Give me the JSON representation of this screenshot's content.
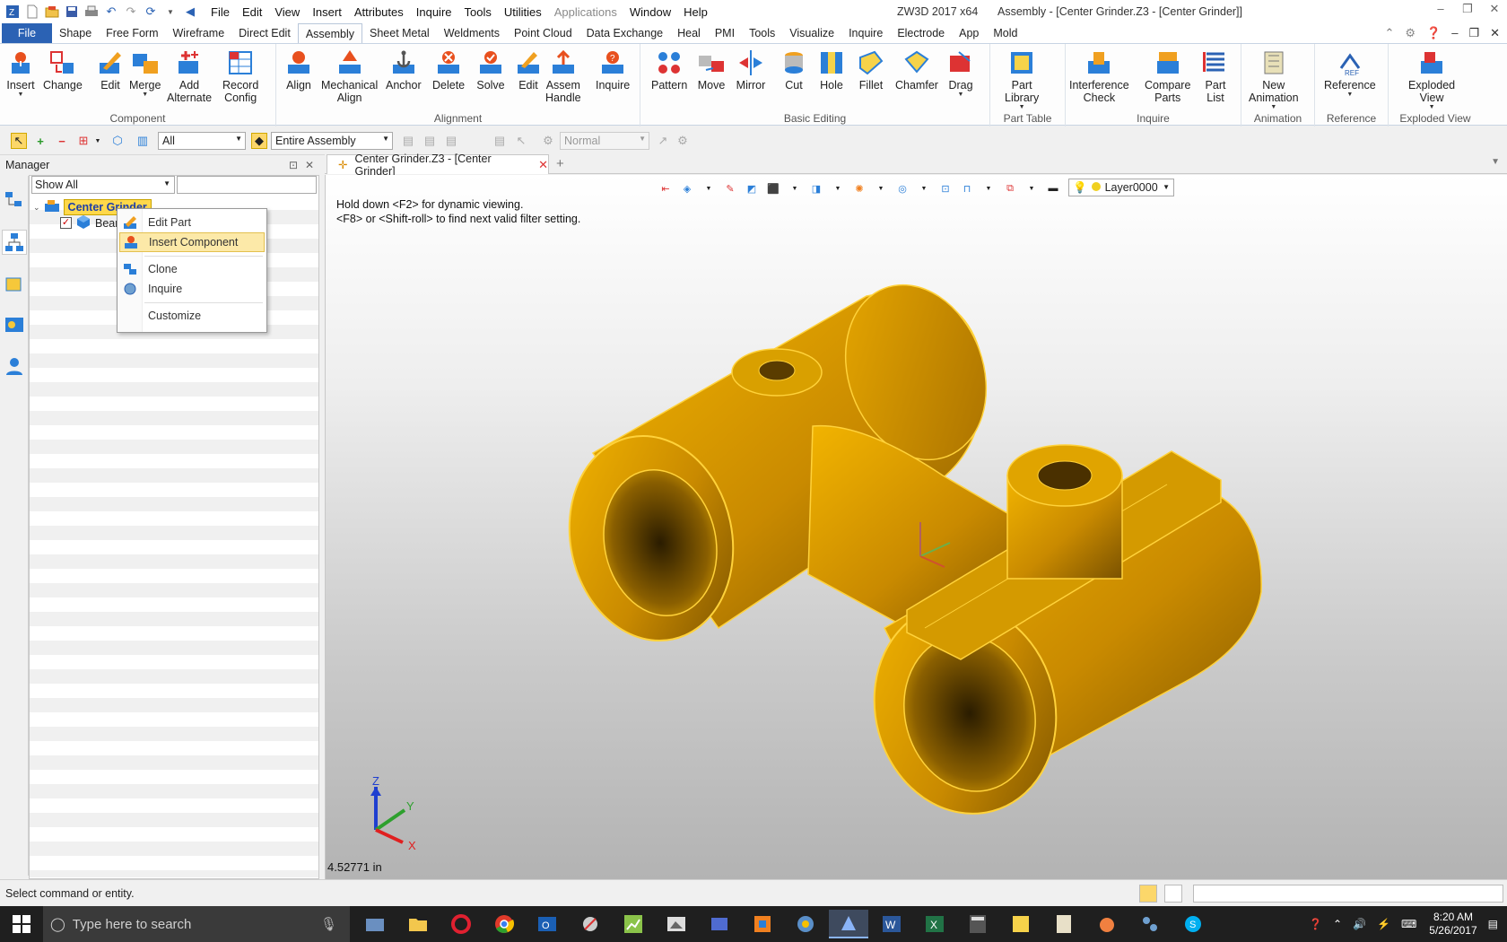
{
  "title_bar": {
    "app_name": "ZW3D 2017  x64",
    "document_title": "Assembly - [Center Grinder.Z3 - [Center Grinder]]",
    "menu": [
      "File",
      "Edit",
      "View",
      "Insert",
      "Attributes",
      "Inquire",
      "Tools",
      "Utilities",
      "Applications",
      "Window",
      "Help"
    ]
  },
  "ribbon_tabs": [
    "File",
    "Shape",
    "Free Form",
    "Wireframe",
    "Direct Edit",
    "Assembly",
    "Sheet Metal",
    "Weldments",
    "Point Cloud",
    "Data Exchange",
    "Heal",
    "PMI",
    "Tools",
    "Visualize",
    "Inquire",
    "Electrode",
    "App",
    "Mold"
  ],
  "active_tab": "Assembly",
  "ribbon_groups": {
    "component": {
      "label": "Component",
      "buttons": [
        "Insert",
        "Change",
        "Edit",
        "Merge",
        "Add\nAlternate",
        "Record\nConfig"
      ]
    },
    "alignment": {
      "label": "Alignment",
      "buttons": [
        "Align",
        "Mechanical\nAlign",
        "Anchor",
        "Delete",
        "Solve",
        "Edit",
        "Assem\nHandle",
        "Inquire"
      ]
    },
    "basic_editing": {
      "label": "Basic Editing",
      "buttons": [
        "Pattern",
        "Move",
        "Mirror",
        "Cut",
        "Hole",
        "Fillet",
        "Chamfer",
        "Drag"
      ]
    },
    "part_table": {
      "label": "Part Table",
      "buttons": [
        "Part\nLibrary"
      ]
    },
    "inquire": {
      "label": "Inquire",
      "buttons": [
        "Interference\nCheck",
        "Compare\nParts",
        "Part\nList"
      ]
    },
    "animation": {
      "label": "Animation",
      "buttons": [
        "New\nAnimation"
      ]
    },
    "reference": {
      "label": "Reference",
      "buttons": [
        "Reference"
      ]
    },
    "exploded_view": {
      "label": "Exploded View",
      "buttons": [
        "Exploded\nView"
      ]
    }
  },
  "filter_toolbar": {
    "filter_value": "All",
    "scope_value": "Entire Assembly",
    "mode_value": "Normal"
  },
  "manager": {
    "title": "Manager",
    "filter_value": "Show All",
    "tree_root": "Center Grinder",
    "tree_child": "Bear"
  },
  "context_menu": {
    "items": [
      "Edit Part",
      "Insert Component",
      "Clone",
      "Inquire",
      "Customize"
    ],
    "highlighted": "Insert Component"
  },
  "document_tab": {
    "label": "Center Grinder.Z3 - [Center Grinder]"
  },
  "viewport": {
    "hint_line1": "Hold down <F2> for dynamic viewing.",
    "hint_line2": "<F8> or <Shift-roll> to find next valid filter setting.",
    "layer": "Layer0000",
    "measure": "4.52771 in",
    "axis_labels": {
      "x": "X",
      "y": "Y",
      "z": "Z"
    },
    "part_color": "#e6a400"
  },
  "status_bar": {
    "message": "Select command or entity."
  },
  "taskbar": {
    "search_placeholder": "Type here to search",
    "time": "8:20 AM",
    "date": "5/26/2017"
  },
  "colors": {
    "file_tab": "#2b62b4",
    "highlight": "#fce9a8",
    "tree_selected": "#ffd84a"
  }
}
